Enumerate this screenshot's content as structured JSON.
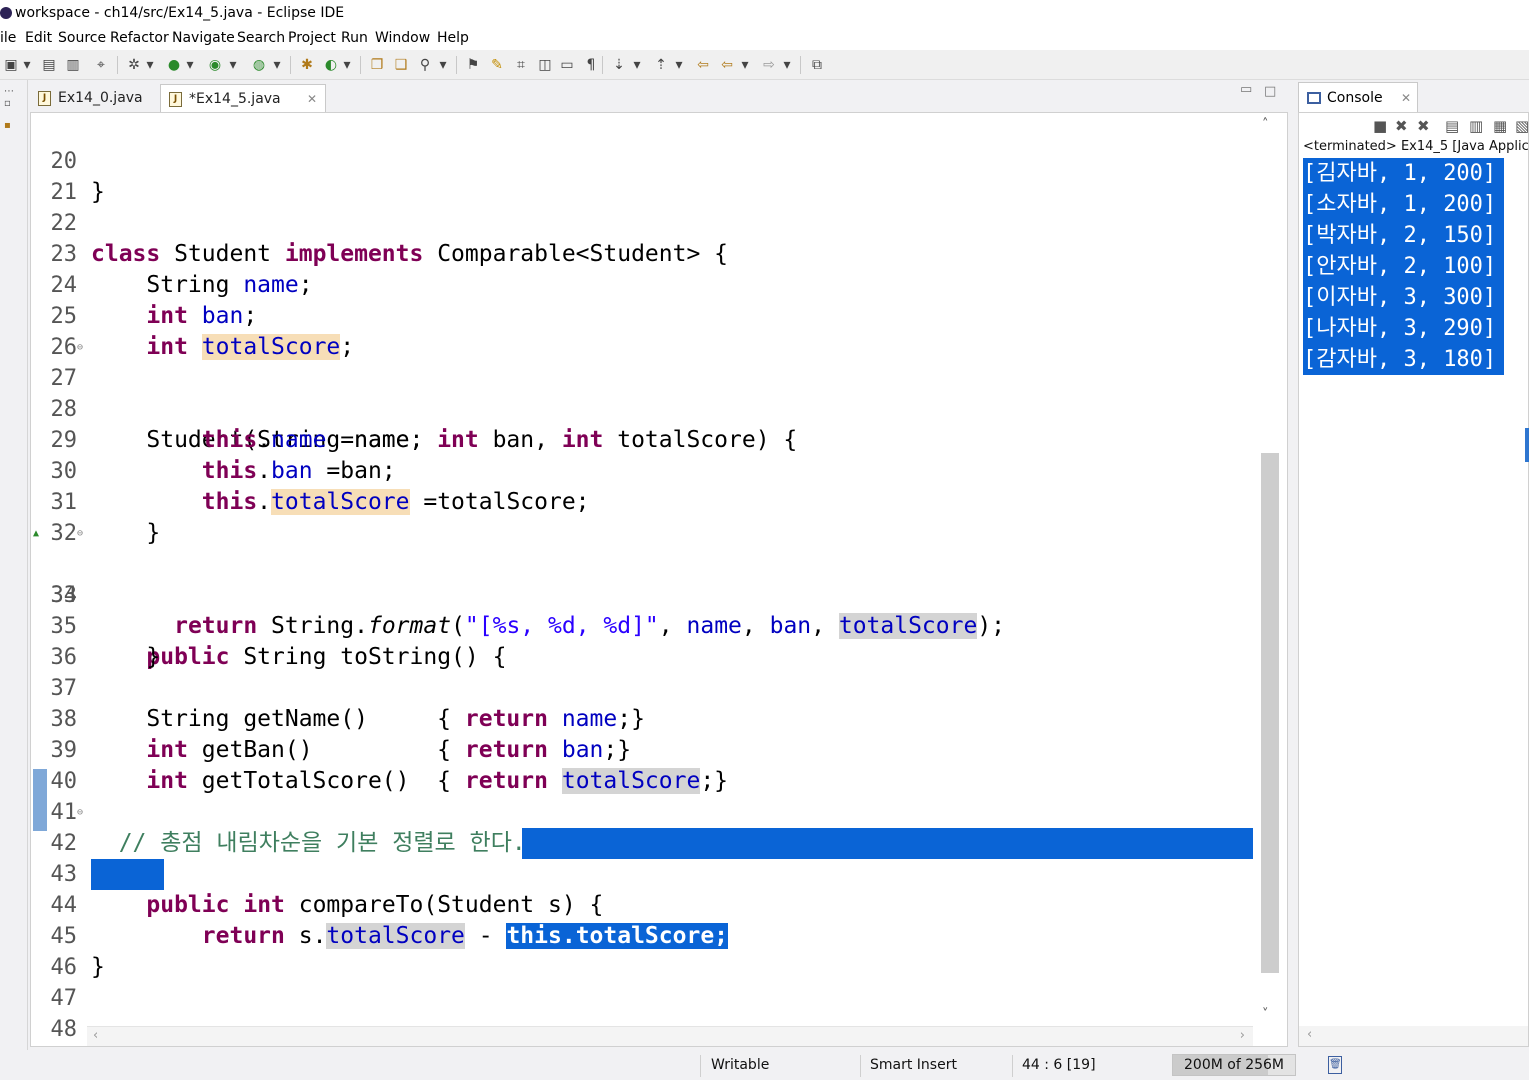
{
  "window": {
    "title": "workspace - ch14/src/Ex14_5.java - Eclipse IDE"
  },
  "menu": [
    "File",
    "Edit",
    "Source",
    "Refactor",
    "Navigate",
    "Search",
    "Project",
    "Run",
    "Window",
    "Help"
  ],
  "menu_visible": [
    "ile",
    "Edit",
    "Source",
    "Refactor",
    "Navigate",
    "Search",
    "Project",
    "Run",
    "Window",
    "Help"
  ],
  "editor_tabs": [
    {
      "label": "Ex14_0.java",
      "active": false
    },
    {
      "label": "*Ex14_5.java",
      "active": true
    }
  ],
  "code_lines": [
    {
      "n": "20"
    },
    {
      "n": "21"
    },
    {
      "n": "22"
    },
    {
      "n": "23"
    },
    {
      "n": "24"
    },
    {
      "n": "25"
    },
    {
      "n": "26"
    },
    {
      "n": "27"
    },
    {
      "n": "28"
    },
    {
      "n": "29"
    },
    {
      "n": "30"
    },
    {
      "n": "31"
    },
    {
      "n": "32"
    },
    {
      "n": "33"
    },
    {
      "n": "34"
    },
    {
      "n": "35"
    },
    {
      "n": "36"
    },
    {
      "n": "37"
    },
    {
      "n": "38"
    },
    {
      "n": "39"
    },
    {
      "n": "40"
    },
    {
      "n": "41"
    },
    {
      "n": "42"
    },
    {
      "n": "43"
    },
    {
      "n": "44"
    },
    {
      "n": "45"
    },
    {
      "n": "46"
    },
    {
      "n": "47"
    },
    {
      "n": "48"
    }
  ],
  "code": {
    "l20": "}",
    "l22_kw": "class",
    "l22_a": " Student ",
    "l22_kw2": "implements",
    "l22_b": " Comparable<Student> {",
    "l23_a": "    String ",
    "l23_f": "name",
    "l23_b": ";",
    "l24_kw": "int",
    "l24_f": "ban",
    "l24_b": ";",
    "l25_kw": "int",
    "l25_f": "totalScore",
    "l25_b": ";",
    "l27_a": "    Student(String name, ",
    "l27_kw": "int",
    "l27_b": " ban, ",
    "l27_kw2": "int",
    "l27_c": " totalScore) {",
    "this": "this",
    "l28_f": "name",
    "l28_b": " =name;",
    "l29_f": "ban",
    "l29_b": " =ban;",
    "l30_f": "totalScore",
    "l30_b": " =totalScore;",
    "l31": "    }",
    "l33_kw": "public",
    "l33_a": " String toString() {",
    "l34_kw": "return",
    "l34_a": " String.",
    "l34_i": "format",
    "l34_b": "(",
    "l34_s": "\"[%s, %d, %d]\"",
    "l34_c": ", ",
    "l34_f1": "name",
    "l34_d": ", ",
    "l34_f2": "ban",
    "l34_e": ", ",
    "l34_f3": "totalScore",
    "l34_g": ");",
    "l35": "    }",
    "l37_a": "    String getName()     { ",
    "l37_kw": "return",
    "l37_f": "name",
    "l37_b": ";}",
    "l38_kw": "int",
    "l38_a": " getBan()         { ",
    "l38_kw2": "return",
    "l38_f": "ban",
    "l38_b": ";}",
    "l39_kw": "int",
    "l39_a": " getTotalScore()  { ",
    "l39_kw2": "return",
    "l39_f": "totalScore",
    "l39_b": ";}",
    "l41": "  // 총점 내림차순을 기본 정렬로 한다.",
    "l42_kw": "public",
    "l42_kw2": "int",
    "l42_a": " compareTo(Student s) {",
    "l43_kw": "return",
    "l43_a": " s.",
    "l43_f": "totalScore",
    "l43_b": " - ",
    "l43_sel": "this.totalScore;",
    "l44": "}",
    "l45": "}"
  },
  "console": {
    "tab_label": "Console",
    "terminated": "<terminated> Ex14_5 [Java Applica",
    "output": [
      "[김자바, 1, 200]",
      "[소자바, 1, 200]",
      "[박자바, 2, 150]",
      "[안자바, 2, 100]",
      "[이자바, 3, 300]",
      "[나자바, 3, 290]",
      "[감자바, 3, 180]"
    ]
  },
  "status": {
    "writable": "Writable",
    "insert_mode": "Smart Insert",
    "position": "44 : 6 [19]",
    "heap": "200M of 256M",
    "heap_fraction": 0.78
  },
  "colors": {
    "keyword": "#7f0055",
    "field": "#0000c0",
    "string": "#2a00ff",
    "selection": "#0a64d6",
    "occurrence": "#f7deb7"
  }
}
